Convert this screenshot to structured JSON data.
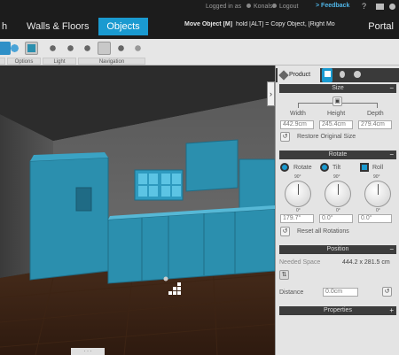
{
  "header": {
    "tabs": [
      {
        "label": "h"
      },
      {
        "label": "Walls & Floors"
      },
      {
        "label": "Objects"
      }
    ],
    "logged_in": "Logged in as",
    "user": "Konalst",
    "logout": "Logout",
    "feedback": "Feedback",
    "help": "?",
    "hint_bold": "Move Object [M]",
    "hint_rest": "hold [ALT] = Copy Object, [Right Mo",
    "portal": "Portal"
  },
  "toolbar": {
    "groups": [
      {
        "label": "Options"
      },
      {
        "label": "Light"
      },
      {
        "label": "Navigation"
      }
    ],
    "icons": [
      "camera-icon",
      "cube-icon",
      "view-icon",
      "bulb-icon",
      "lamp-icon",
      "hand-icon",
      "zoom-icon",
      "rotate-icon"
    ]
  },
  "viewport": {
    "collapse": "›",
    "bottom_label": "· · ·"
  },
  "panel": {
    "tab_product": "Product",
    "size": {
      "title": "Size",
      "minus": "−",
      "width_label": "Width",
      "height_label": "Height",
      "depth_label": "Depth",
      "width": "442.9cm",
      "height": "245.4cm",
      "depth": "279.4cm",
      "restore": "Restore Original Size"
    },
    "rotate": {
      "title": "Rotate",
      "minus": "−",
      "rotate_label": "Rotate",
      "tilt_label": "Tilt",
      "roll_label": "Roll",
      "rotate_value": "179.7°",
      "tilt_value": "0.0°",
      "roll_value": "0.0°",
      "reset": "Reset all Rotations",
      "dial_top": "90°",
      "dial_bottom": "0°"
    },
    "position": {
      "title": "Position",
      "minus": "−",
      "needed_label": "Needed Space",
      "needed_value": "444.2 x 281.5 cm",
      "distance_label": "Distance",
      "distance_value": "0.0cm"
    },
    "properties": {
      "title": "Properties",
      "plus": "+"
    }
  },
  "colors": {
    "accent": "#1a9ad0",
    "cabinet": "#2b8fae"
  }
}
